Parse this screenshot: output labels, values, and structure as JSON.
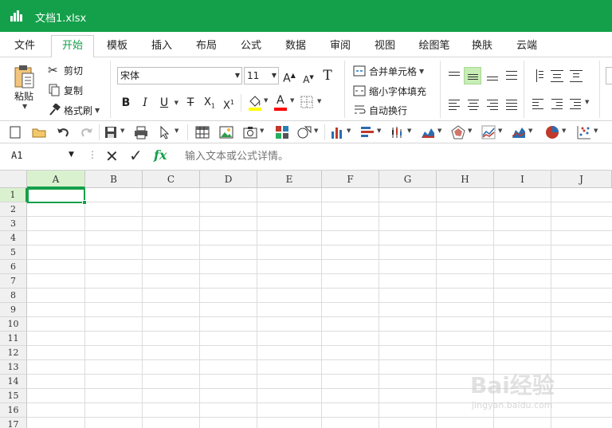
{
  "window": {
    "title": "文档1.xlsx"
  },
  "menu": {
    "tabs": [
      "文件",
      "开始",
      "模板",
      "插入",
      "布局",
      "公式",
      "数据",
      "审阅",
      "视图",
      "绘图笔",
      "换肤",
      "云端"
    ],
    "active": "开始"
  },
  "ribbon": {
    "paste_label": "粘贴",
    "cut_label": "剪切",
    "copy_label": "复制",
    "format_painter_label": "格式刷",
    "font_name": "宋体",
    "font_size": "11",
    "merge_label": "合并单元格",
    "shrink_label": "缩小字体填充",
    "wrap_label": "自动换行"
  },
  "formula_bar": {
    "cell_ref": "A1",
    "fx": "fx",
    "placeholder": "输入文本或公式详情。"
  },
  "grid": {
    "columns": [
      "A",
      "B",
      "C",
      "D",
      "E",
      "F",
      "G",
      "H",
      "I",
      "J"
    ],
    "rows": [
      "1",
      "2",
      "3",
      "4",
      "5",
      "6",
      "7",
      "8",
      "9",
      "10",
      "11",
      "12",
      "13",
      "14",
      "15",
      "16",
      "17"
    ],
    "selected_cell": "A1"
  },
  "watermark": {
    "text": "Bai经验",
    "sub": "jingyan.baidu.com"
  },
  "colors": {
    "accent": "#14a04b",
    "highlight": "#ffff00",
    "font_color": "#ff0000"
  }
}
